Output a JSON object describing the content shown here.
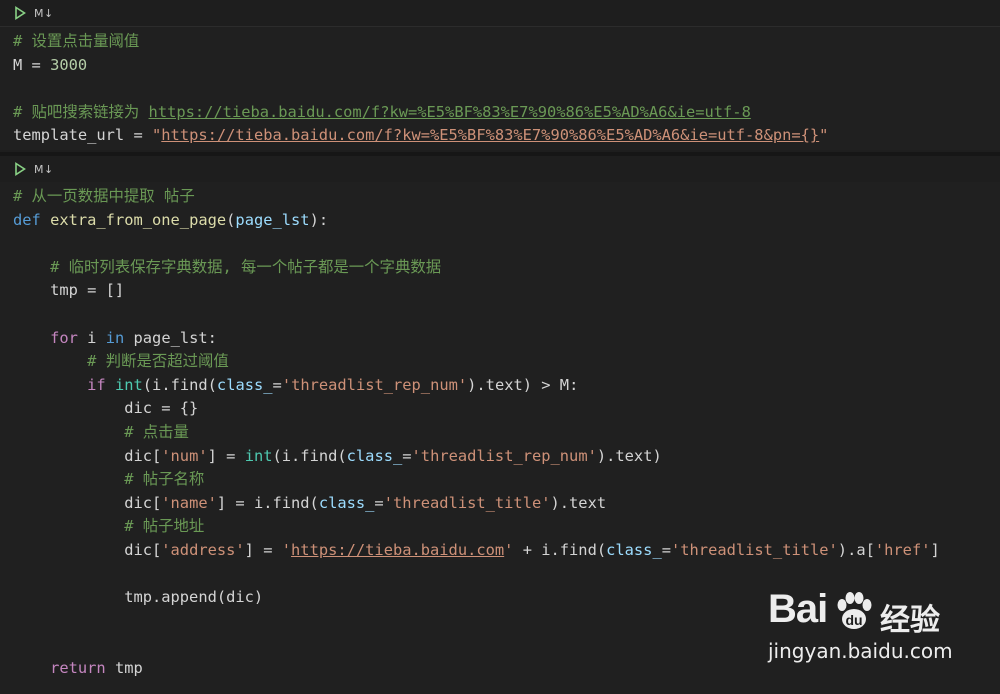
{
  "cells": [
    {
      "badge": "M↓",
      "lines": [
        [
          {
            "t": "# 设置点击量阈值",
            "c": "cmt"
          }
        ],
        [
          {
            "t": "M = ",
            "c": ""
          },
          {
            "t": "3000",
            "c": "num"
          }
        ],
        [],
        [
          {
            "t": "# 贴吧搜索链接为 ",
            "c": "cmt"
          },
          {
            "t": "https://tieba.baidu.com/f?kw=%E5%BF%83%E7%90%86%E5%AD%A6&ie=utf-8",
            "c": "url-cmt"
          }
        ],
        [
          {
            "t": "template_url = ",
            "c": ""
          },
          {
            "t": "\"",
            "c": "str"
          },
          {
            "t": "https://tieba.baidu.com/f?kw=%E5%BF%83%E7%90%86%E5%AD%A6&ie=utf-8&pn={}",
            "c": "lnk"
          },
          {
            "t": "\"",
            "c": "str"
          }
        ]
      ]
    },
    {
      "badge": "M↓",
      "lines": [
        [
          {
            "t": "# 从一页数据中提取 帖子",
            "c": "cmt"
          }
        ],
        [
          {
            "t": "def ",
            "c": "kw"
          },
          {
            "t": "extra_from_one_page",
            "c": "fn"
          },
          {
            "t": "(",
            "c": ""
          },
          {
            "t": "page_lst",
            "c": "var"
          },
          {
            "t": "):",
            "c": ""
          }
        ],
        [],
        [
          {
            "t": "    # 临时列表保存字典数据, 每一个帖子都是一个字典数据",
            "c": "cmt"
          }
        ],
        [
          {
            "t": "    tmp = []",
            "c": ""
          }
        ],
        [],
        [
          {
            "t": "    ",
            "c": ""
          },
          {
            "t": "for",
            "c": "kw2"
          },
          {
            "t": " i ",
            "c": ""
          },
          {
            "t": "in",
            "c": "kw"
          },
          {
            "t": " page_lst:",
            "c": ""
          }
        ],
        [
          {
            "t": "        # 判断是否超过阈值",
            "c": "cmt"
          }
        ],
        [
          {
            "t": "        ",
            "c": ""
          },
          {
            "t": "if",
            "c": "kw2"
          },
          {
            "t": " ",
            "c": ""
          },
          {
            "t": "int",
            "c": "bi"
          },
          {
            "t": "(i.find(",
            "c": ""
          },
          {
            "t": "class_",
            "c": "var"
          },
          {
            "t": "=",
            "c": ""
          },
          {
            "t": "'threadlist_rep_num'",
            "c": "str"
          },
          {
            "t": ").text) > M:",
            "c": ""
          }
        ],
        [
          {
            "t": "            dic = {}",
            "c": ""
          }
        ],
        [
          {
            "t": "            # 点击量",
            "c": "cmt"
          }
        ],
        [
          {
            "t": "            dic[",
            "c": ""
          },
          {
            "t": "'num'",
            "c": "str"
          },
          {
            "t": "] = ",
            "c": ""
          },
          {
            "t": "int",
            "c": "bi"
          },
          {
            "t": "(i.find(",
            "c": ""
          },
          {
            "t": "class_",
            "c": "var"
          },
          {
            "t": "=",
            "c": ""
          },
          {
            "t": "'threadlist_rep_num'",
            "c": "str"
          },
          {
            "t": ").text)",
            "c": ""
          }
        ],
        [
          {
            "t": "            # 帖子名称",
            "c": "cmt"
          }
        ],
        [
          {
            "t": "            dic[",
            "c": ""
          },
          {
            "t": "'name'",
            "c": "str"
          },
          {
            "t": "] = i.find(",
            "c": ""
          },
          {
            "t": "class_",
            "c": "var"
          },
          {
            "t": "=",
            "c": ""
          },
          {
            "t": "'threadlist_title'",
            "c": "str"
          },
          {
            "t": ").text",
            "c": ""
          }
        ],
        [
          {
            "t": "            # 帖子地址",
            "c": "cmt"
          }
        ],
        [
          {
            "t": "            dic[",
            "c": ""
          },
          {
            "t": "'address'",
            "c": "str"
          },
          {
            "t": "] = ",
            "c": ""
          },
          {
            "t": "'",
            "c": "str"
          },
          {
            "t": "https://tieba.baidu.com",
            "c": "lnk"
          },
          {
            "t": "'",
            "c": "str"
          },
          {
            "t": " + i.find(",
            "c": ""
          },
          {
            "t": "class_",
            "c": "var"
          },
          {
            "t": "=",
            "c": ""
          },
          {
            "t": "'threadlist_title'",
            "c": "str"
          },
          {
            "t": ").a[",
            "c": ""
          },
          {
            "t": "'href'",
            "c": "str"
          },
          {
            "t": "]",
            "c": ""
          }
        ],
        [],
        [
          {
            "t": "            tmp.append(dic)",
            "c": ""
          }
        ],
        [],
        [],
        [
          {
            "t": "    ",
            "c": ""
          },
          {
            "t": "return",
            "c": "kw2"
          },
          {
            "t": " tmp",
            "c": ""
          }
        ]
      ]
    }
  ],
  "watermark": {
    "logo": "Bai",
    "logo_tail": "du",
    "product": "经验",
    "url": "jingyan.baidu.com"
  }
}
